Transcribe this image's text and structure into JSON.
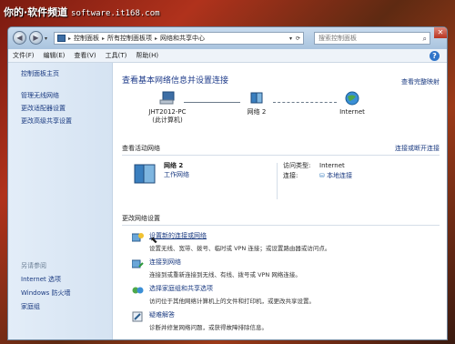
{
  "watermark": {
    "prefix": "你的·软件频道",
    "site": "software.it168.com"
  },
  "titlebar": {
    "breadcrumbs": [
      "控制面板",
      "所有控制面板项",
      "网络和共享中心"
    ],
    "search_placeholder": "搜索控制面板"
  },
  "menu": [
    "文件(F)",
    "编辑(E)",
    "查看(V)",
    "工具(T)",
    "帮助(H)"
  ],
  "sidebar": {
    "home": "控制面板主页",
    "items": [
      "管理无线网络",
      "更改适配器设置",
      "更改高级共享设置"
    ],
    "see_also_title": "另请参阅",
    "see_also": [
      "Internet 选项",
      "Windows 防火墙",
      "家庭组"
    ]
  },
  "main": {
    "title": "查看基本网络信息并设置连接",
    "full_map": "查看完整映射",
    "map": {
      "pc_name": "JHT2012-PC",
      "pc_sub": "(此计算机)",
      "network": "网络  2",
      "internet": "Internet"
    },
    "active": {
      "heading": "查看活动网络",
      "connect_link": "连接或断开连接",
      "net_name": "网络  2",
      "net_type": "工作网络",
      "access_label": "访问类型:",
      "access_value": "Internet",
      "conn_label": "连接:",
      "conn_value": "本地连接"
    },
    "settings_title": "更改网络设置",
    "tasks": [
      {
        "link": "设置新的连接或网络",
        "desc": "设置无线、宽带、拨号、临时或 VPN 连接；或设置路由器或访问点。"
      },
      {
        "link": "连接到网络",
        "desc": "连接到或重新连接到无线、有线、拨号或 VPN 网络连接。"
      },
      {
        "link": "选择家庭组和共享选项",
        "desc": "访问位于其他网络计算机上的文件和打印机，或更改共享设置。"
      },
      {
        "link": "疑难解答",
        "desc": "诊断并修复网络问题，或获得故障排除信息。"
      }
    ]
  },
  "colors": {
    "link": "#1a3a80",
    "title": "#1e3b8a",
    "chrome": "#dde8f2"
  },
  "icons": [
    "computer-icon",
    "network-icon",
    "globe-icon",
    "search-icon",
    "help-icon",
    "close-icon"
  ]
}
